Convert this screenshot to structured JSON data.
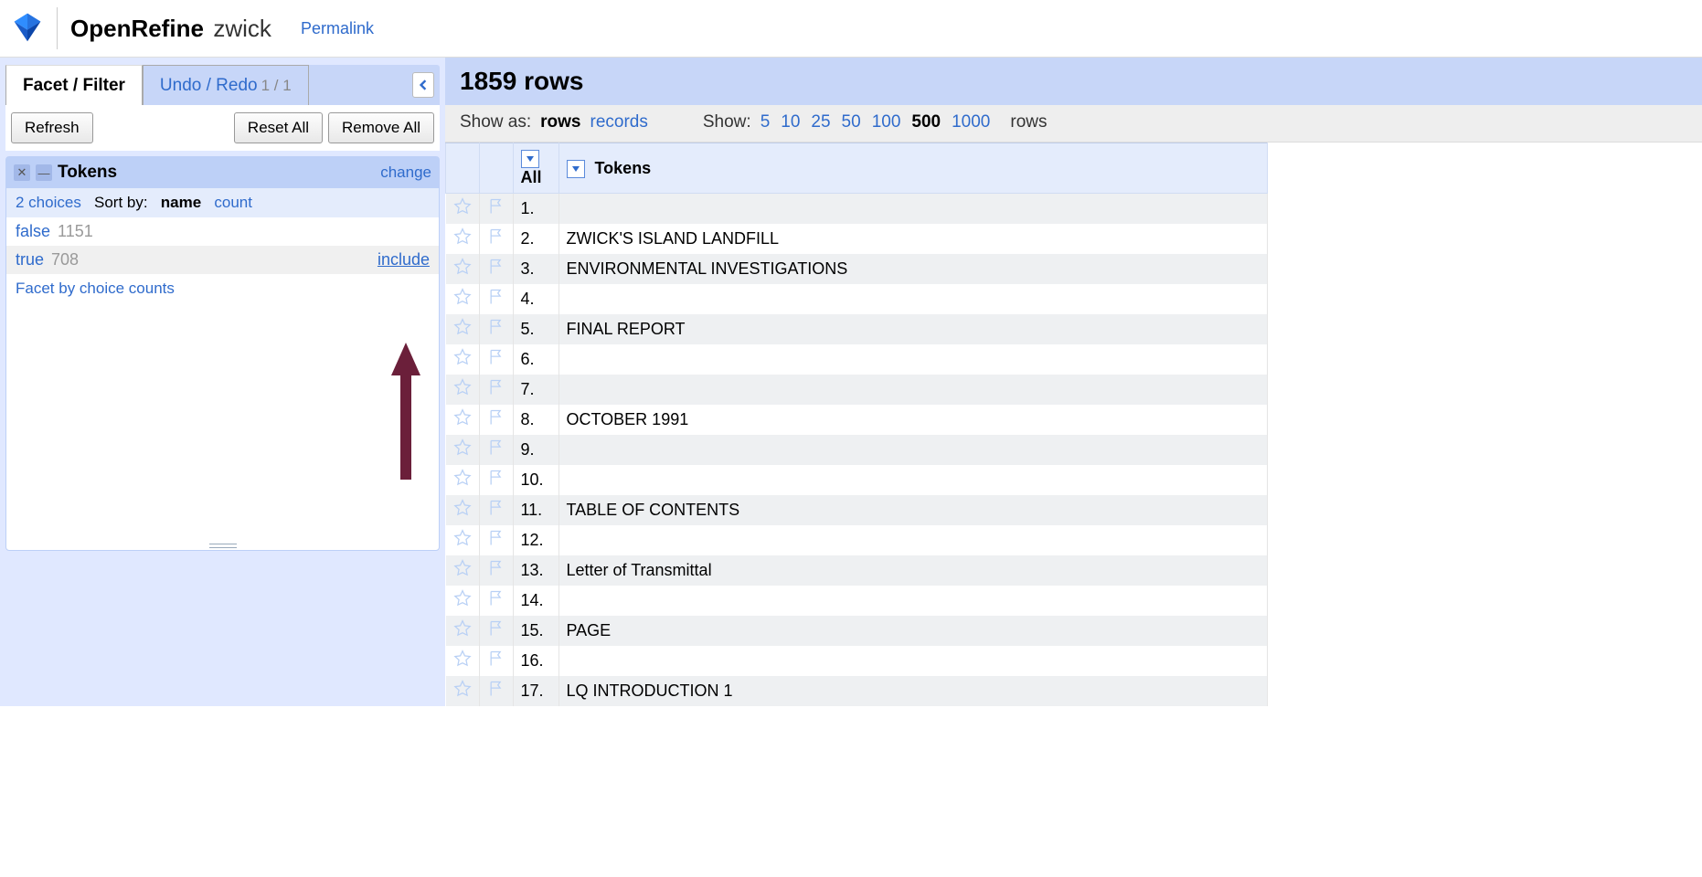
{
  "header": {
    "app_name": "OpenRefine",
    "project_name": "zwick",
    "permalink_label": "Permalink"
  },
  "tabs": {
    "facet_filter": "Facet / Filter",
    "undo_redo": "Undo / Redo",
    "undo_count": "1 / 1"
  },
  "left_actions": {
    "refresh": "Refresh",
    "reset_all": "Reset All",
    "remove_all": "Remove All"
  },
  "facet": {
    "title": "Tokens",
    "change": "change",
    "choices_label": "2 choices",
    "sort_by_label": "Sort by:",
    "sort_name": "name",
    "sort_count": "count",
    "choices": [
      {
        "value": "false",
        "count": "1151",
        "highlight": false,
        "show_include": false
      },
      {
        "value": "true",
        "count": "708",
        "highlight": true,
        "show_include": true
      }
    ],
    "include_label": "include",
    "footer": "Facet by choice counts"
  },
  "summary": {
    "text": "1859 rows"
  },
  "show_as": {
    "label": "Show as:",
    "rows": "rows",
    "records": "records",
    "active": "rows"
  },
  "page_size": {
    "label": "Show:",
    "options": [
      "5",
      "10",
      "25",
      "50",
      "100",
      "500",
      "1000"
    ],
    "active": "500",
    "suffix": "rows"
  },
  "columns": {
    "all": "All",
    "tokens": "Tokens"
  },
  "rows": [
    {
      "n": "1.",
      "tokens": ""
    },
    {
      "n": "2.",
      "tokens": "ZWICK'S ISLAND LANDFILL"
    },
    {
      "n": "3.",
      "tokens": "ENVIRONMENTAL INVESTIGATIONS"
    },
    {
      "n": "4.",
      "tokens": ""
    },
    {
      "n": "5.",
      "tokens": "FINAL REPORT"
    },
    {
      "n": "6.",
      "tokens": ""
    },
    {
      "n": "7.",
      "tokens": ""
    },
    {
      "n": "8.",
      "tokens": "OCTOBER 1991"
    },
    {
      "n": "9.",
      "tokens": ""
    },
    {
      "n": "10.",
      "tokens": ""
    },
    {
      "n": "11.",
      "tokens": "TABLE OF CONTENTS"
    },
    {
      "n": "12.",
      "tokens": ""
    },
    {
      "n": "13.",
      "tokens": "Letter of Transmittal"
    },
    {
      "n": "14.",
      "tokens": ""
    },
    {
      "n": "15.",
      "tokens": "PAGE"
    },
    {
      "n": "16.",
      "tokens": ""
    },
    {
      "n": "17.",
      "tokens": "LQ INTRODUCTION 1"
    }
  ],
  "annotation": {
    "arrow_color": "#6b1f3a"
  }
}
